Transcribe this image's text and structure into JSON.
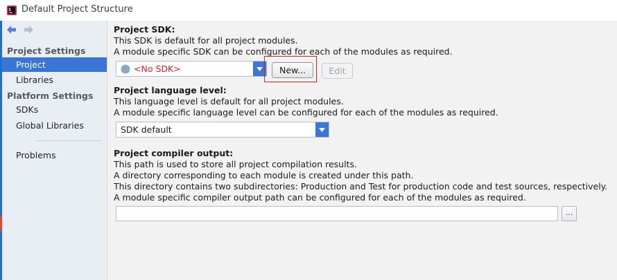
{
  "window": {
    "title": "Default Project Structure"
  },
  "sidebar": {
    "sections": [
      {
        "header": "Project Settings",
        "items": [
          "Project",
          "Libraries"
        ]
      },
      {
        "header": "Platform Settings",
        "items": [
          "SDKs",
          "Global Libraries"
        ]
      }
    ],
    "extra_item": "Problems",
    "selected": "Project"
  },
  "project_sdk": {
    "title": "Project SDK:",
    "desc1": "This SDK is default for all project modules.",
    "desc2": "A module specific SDK can be configured for each of the modules as required.",
    "selected": "<No SDK>",
    "new_button": "New...",
    "edit_button": "Edit"
  },
  "language_level": {
    "title": "Project language level:",
    "desc1": "This language level is default for all project modules.",
    "desc2": "A module specific language level can be configured for each of the modules as required.",
    "selected": "SDK default"
  },
  "compiler_output": {
    "title": "Project compiler output:",
    "desc1": "This path is used to store all project compilation results.",
    "desc2": "A directory corresponding to each module is created under this path.",
    "desc3": "This directory contains two subdirectories: Production and Test for production code and test sources, respectively.",
    "desc4": "A module specific compiler output path can be configured for each of the modules as required.",
    "value": "",
    "browse_label": "..."
  },
  "colors": {
    "accent": "#3875d7",
    "error_text": "#e0201c",
    "highlight": "#e0201c"
  }
}
